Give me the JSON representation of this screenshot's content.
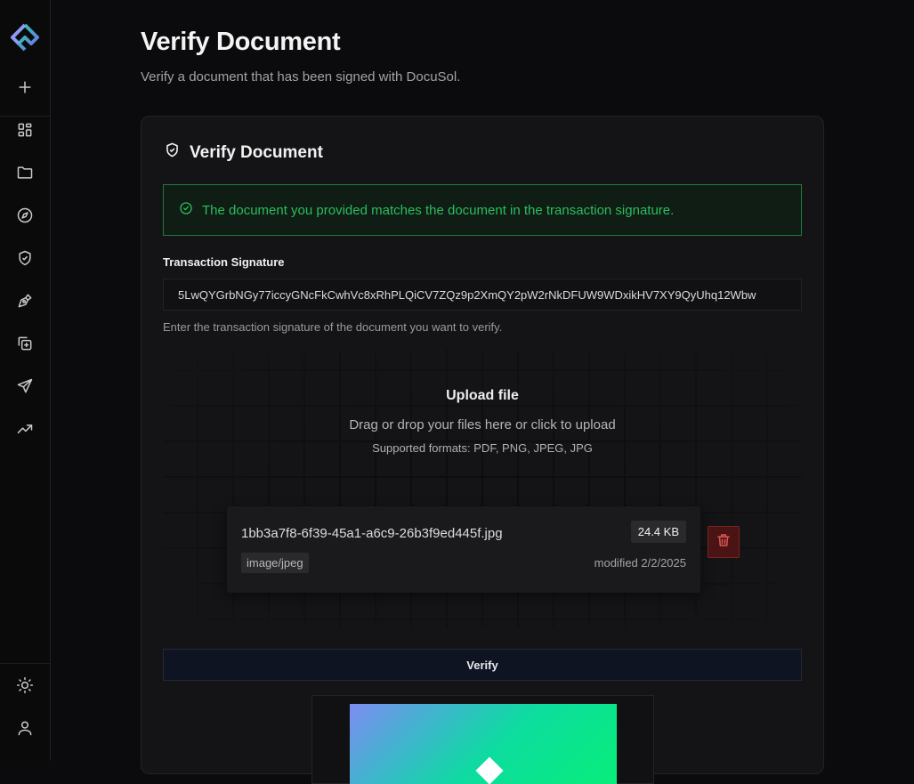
{
  "app": {
    "colors": {
      "accent": "#2bbd5e",
      "danger": "#e15656",
      "background": "#0b0b0d"
    },
    "sidebar": {
      "logo_icon": "docusol-logo-icon",
      "items": [
        {
          "name": "new",
          "icon": "plus-icon"
        },
        {
          "name": "dashboard",
          "icon": "grid-icon"
        },
        {
          "name": "documents",
          "icon": "folder-icon"
        },
        {
          "name": "explore",
          "icon": "compass-icon"
        },
        {
          "name": "verify",
          "icon": "shield-check-icon"
        },
        {
          "name": "sign",
          "icon": "pen-tool-icon"
        },
        {
          "name": "duplicate",
          "icon": "copy-plus-icon"
        },
        {
          "name": "send",
          "icon": "send-icon"
        },
        {
          "name": "analytics",
          "icon": "trending-up-icon"
        }
      ],
      "bottom": [
        {
          "name": "theme",
          "icon": "sun-icon"
        },
        {
          "name": "account",
          "icon": "user-icon"
        }
      ]
    }
  },
  "page": {
    "title": "Verify Document",
    "subtitle": "Verify a document that has been signed with DocuSol."
  },
  "card": {
    "title": "Verify Document",
    "alert": "The document you provided matches the document in the transaction signature.",
    "signature": {
      "label": "Transaction Signature",
      "value": "5LwQYGrbNGy77iccyGNcFkCwhVc8xRhPLQiCV7ZQz9p2XmQY2pW2rNkDFUW9WDxikHV7XY9QyUhq12Wbw",
      "hint": "Enter the transaction signature of the document you want to verify."
    },
    "upload": {
      "title": "Upload file",
      "description": "Drag or drop your files here or click to upload",
      "formats": "Supported formats: PDF, PNG, JPEG, JPG"
    },
    "file": {
      "name": "1bb3a7f8-6f39-45a1-a6c9-26b3f9ed445f.jpg",
      "size": "24.4 KB",
      "type": "image/jpeg",
      "modified": "modified 2/2/2025"
    },
    "verify_label": "Verify"
  }
}
